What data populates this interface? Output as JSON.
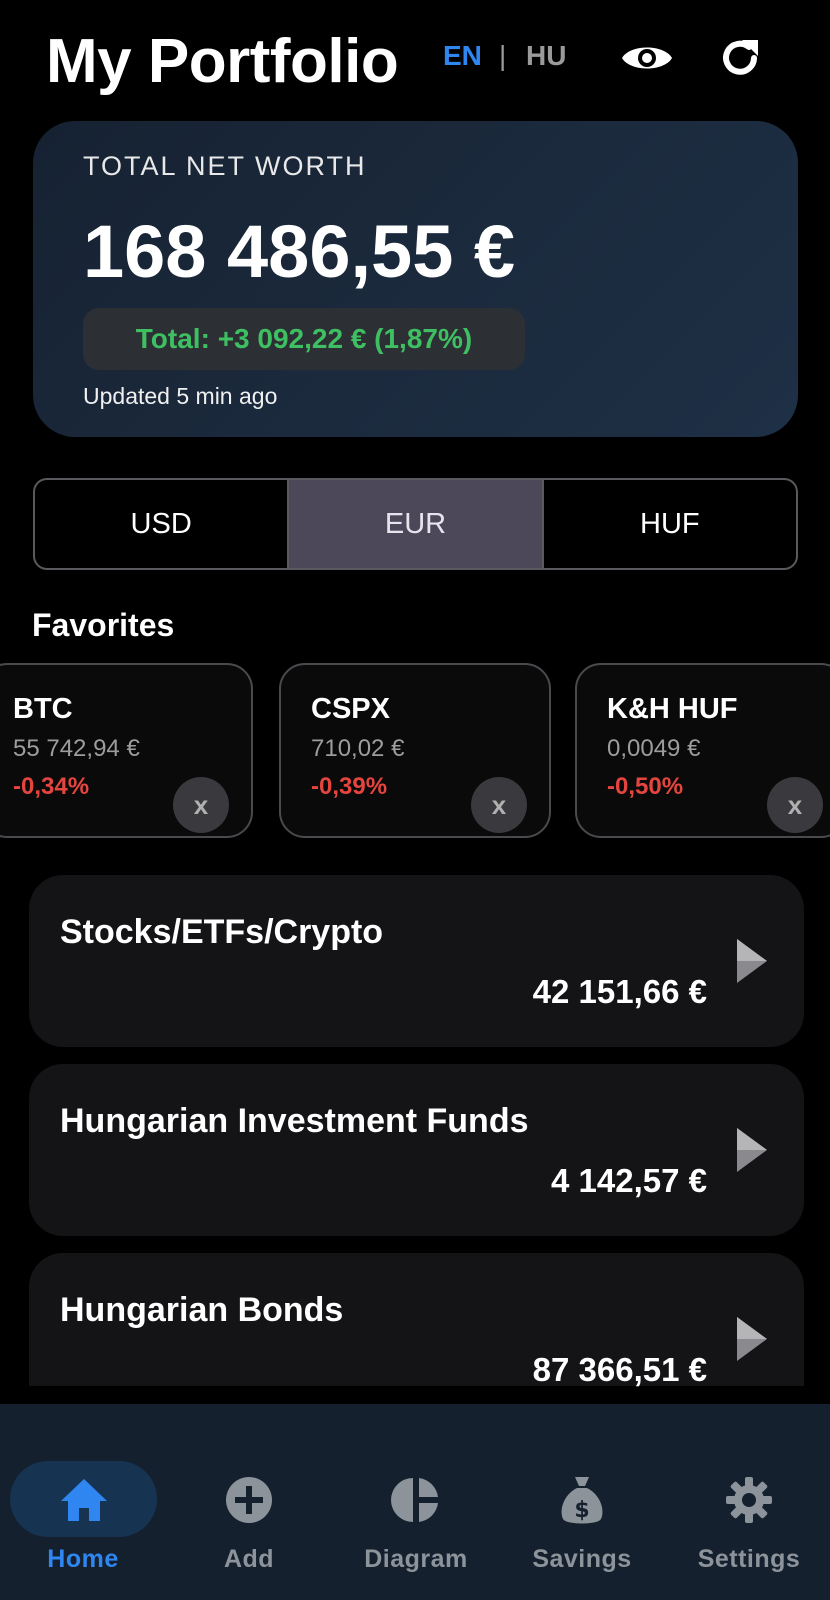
{
  "header": {
    "title": "My Portfolio",
    "lang_en": "EN",
    "lang_separator": "|",
    "lang_hu": "HU",
    "active_lang": "EN"
  },
  "net_worth": {
    "label": "TOTAL NET WORTH",
    "value": "168 486,55 €",
    "change": "Total: +3 092,22 € (1,87%)",
    "updated": "Updated 5 min ago"
  },
  "currency_selector": {
    "options": [
      "USD",
      "EUR",
      "HUF"
    ],
    "selected": "EUR"
  },
  "favorites": {
    "title": "Favorites",
    "items": [
      {
        "name": "BTC",
        "price": "55 742,94 €",
        "change": "-0,34%",
        "remove": "x"
      },
      {
        "name": "CSPX",
        "price": "710,02 €",
        "change": "-0,39%",
        "remove": "x"
      },
      {
        "name": "K&H HUF",
        "price": "0,0049 €",
        "change": "-0,50%",
        "remove": "x"
      }
    ]
  },
  "categories": [
    {
      "name": "Stocks/ETFs/Crypto",
      "value": "42 151,66 €"
    },
    {
      "name": "Hungarian Investment Funds",
      "value": "4 142,57 €"
    },
    {
      "name": "Hungarian Bonds",
      "value": "87 366,51 €"
    }
  ],
  "bottom_nav": {
    "items": [
      {
        "label": "Home",
        "icon": "home-icon"
      },
      {
        "label": "Add",
        "icon": "add-circle-icon"
      },
      {
        "label": "Diagram",
        "icon": "pie-chart-icon"
      },
      {
        "label": "Savings",
        "icon": "money-bag-icon"
      },
      {
        "label": "Settings",
        "icon": "gear-icon"
      }
    ],
    "active": "Home"
  },
  "colors": {
    "accent": "#2f86f0",
    "positive": "#3ec062",
    "negative": "#e5453f",
    "selected_segment": "#4d4859"
  }
}
